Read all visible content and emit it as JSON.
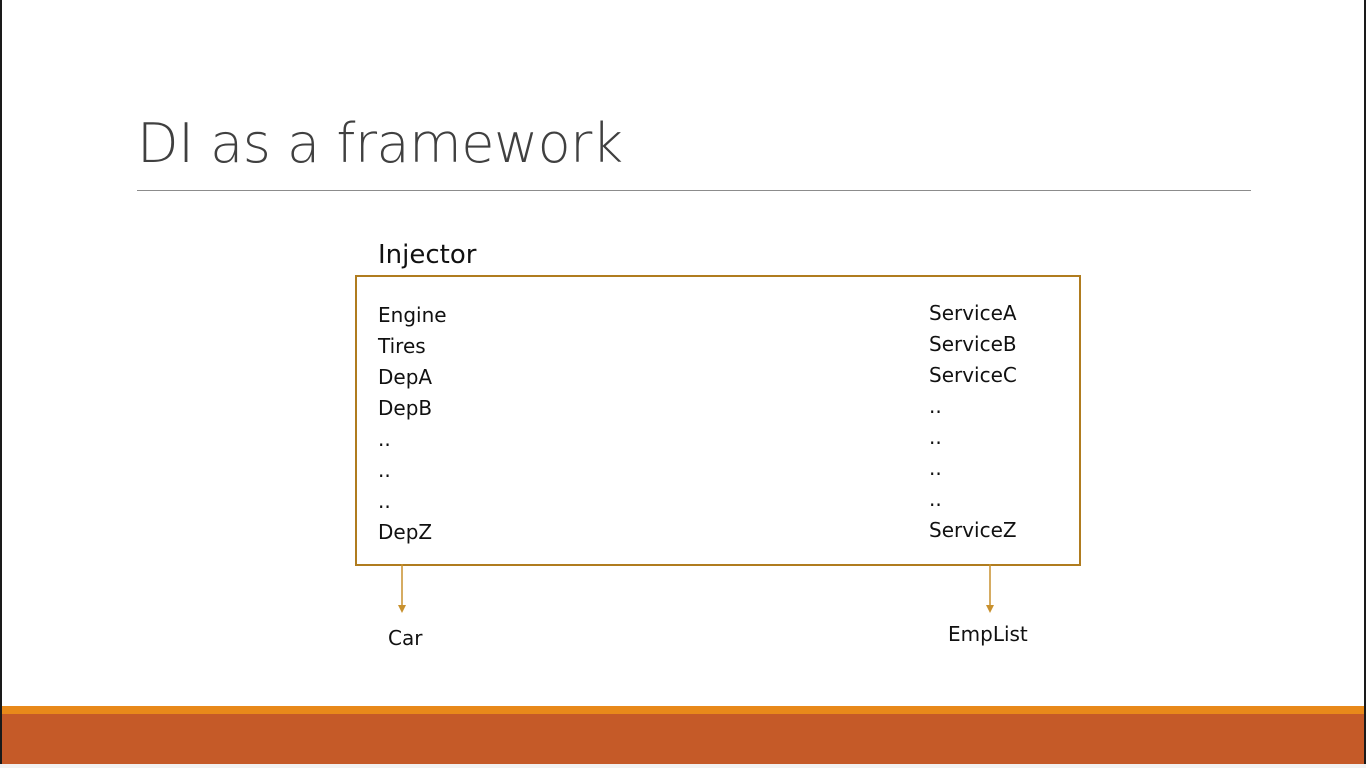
{
  "slide": {
    "title": "DI as a framework"
  },
  "diagram": {
    "container_label": "Injector",
    "left_items": [
      "Engine",
      "Tires",
      "DepA",
      "DepB",
      "..",
      "..",
      "..",
      "DepZ"
    ],
    "right_items": [
      "ServiceA",
      "ServiceB",
      "ServiceC",
      "..",
      "..",
      "..",
      "..",
      "ServiceZ"
    ],
    "left_output": "Car",
    "right_output": "EmpList"
  },
  "colors": {
    "box_border": "#b07c1f",
    "arrow": "#c8912e",
    "footer_accent": "#e8891a",
    "footer_bar": "#c55a28",
    "title_text": "#404040"
  }
}
